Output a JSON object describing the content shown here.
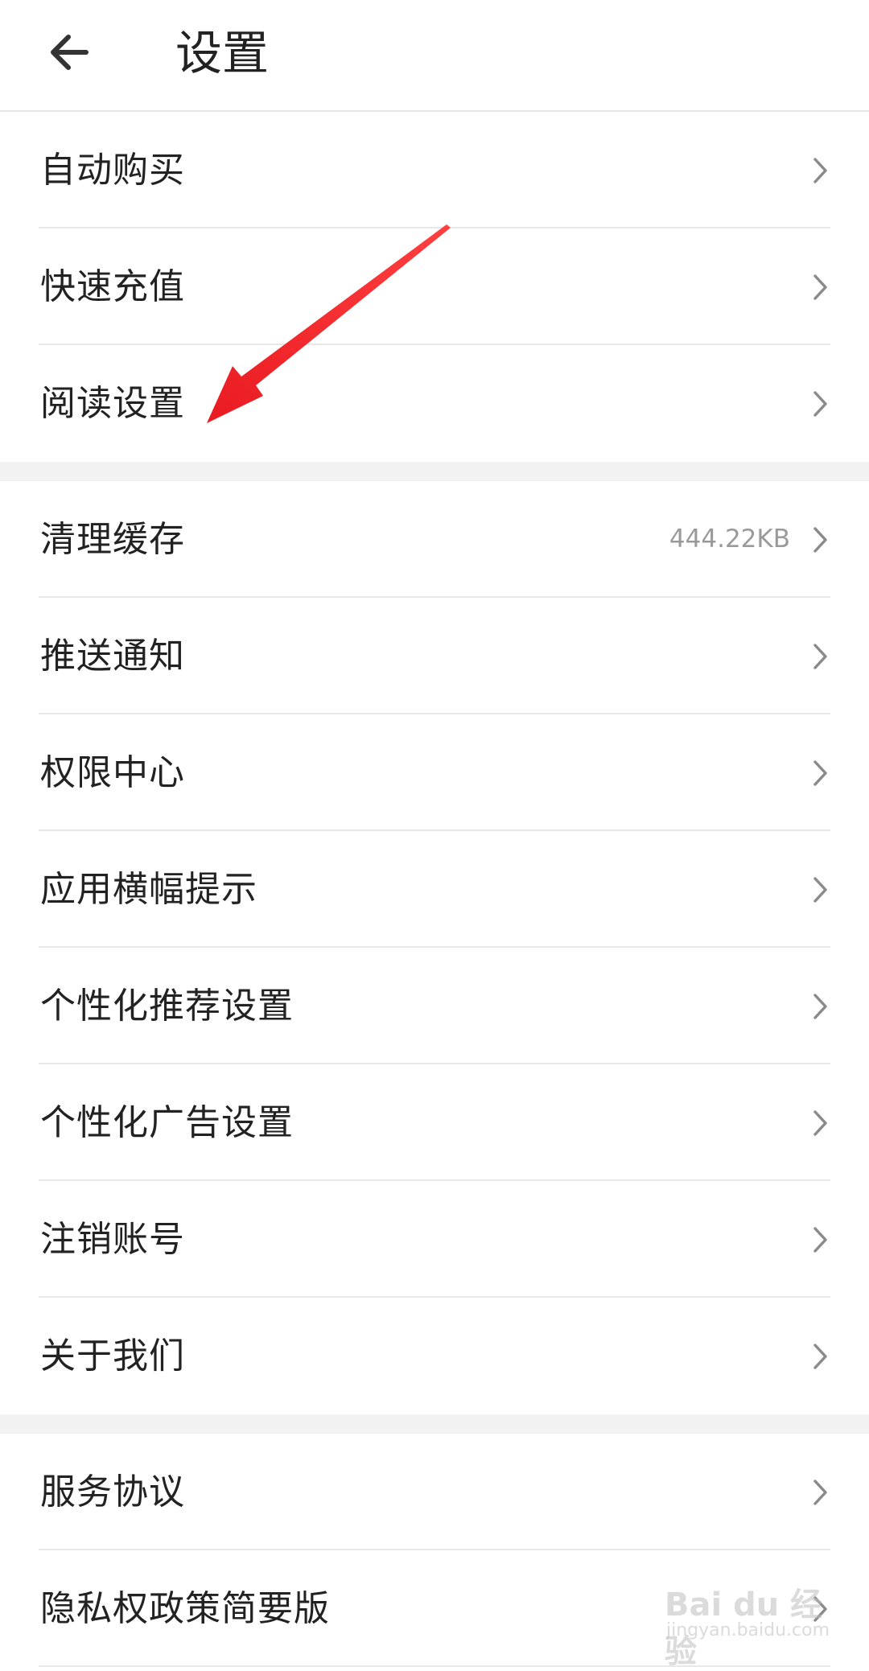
{
  "header": {
    "title": "设置"
  },
  "section1": {
    "items": [
      {
        "label": "自动购买"
      },
      {
        "label": "快速充值"
      },
      {
        "label": "阅读设置"
      }
    ]
  },
  "section2": {
    "items": [
      {
        "label": "清理缓存",
        "value": "444.22KB"
      },
      {
        "label": "推送通知"
      },
      {
        "label": "权限中心"
      },
      {
        "label": "应用横幅提示"
      },
      {
        "label": "个性化推荐设置"
      },
      {
        "label": "个性化广告设置"
      },
      {
        "label": "注销账号"
      },
      {
        "label": "关于我们"
      }
    ]
  },
  "section3": {
    "items": [
      {
        "label": "服务协议"
      },
      {
        "label": "隐私权政策简要版"
      }
    ]
  },
  "watermark": {
    "main": "Bai du 经验",
    "sub": "jingyan.baidu.com"
  },
  "icons": {
    "back": "arrow-left-icon",
    "chevron": "chevron-right-icon"
  },
  "colors": {
    "annotation_arrow": "#e8141b",
    "section_gap": "#f2f2f2",
    "divider": "#e8e8e8"
  }
}
